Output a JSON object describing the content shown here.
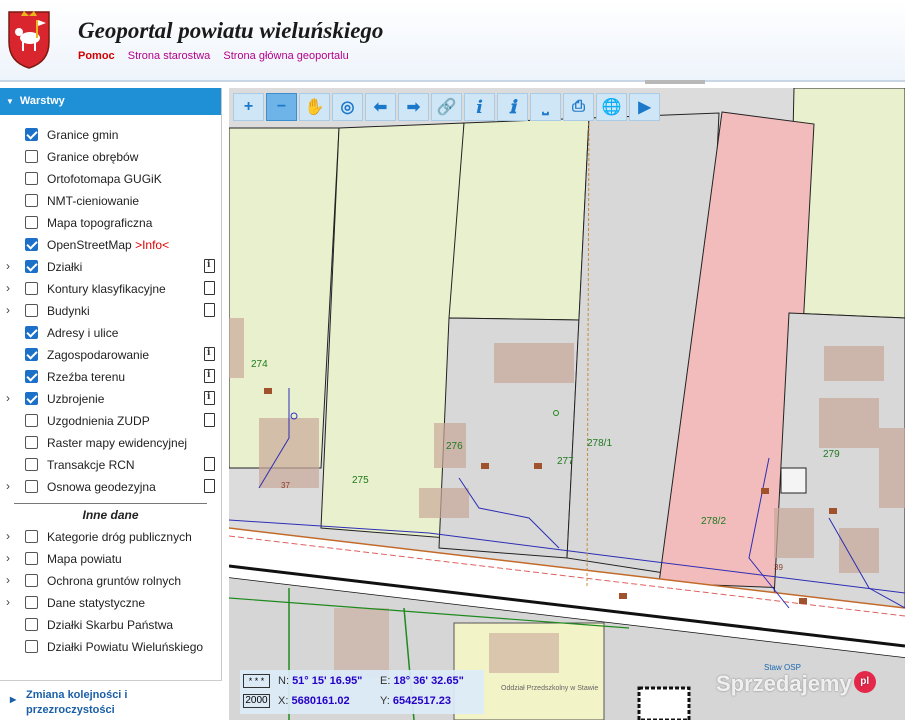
{
  "header": {
    "title": "Geoportal powiatu wieluńskiego",
    "links": {
      "help": "Pomoc",
      "starostwo": "Strona starostwa",
      "main": "Strona główna geoportalu"
    }
  },
  "sidebar": {
    "layers_title": "Warstwy",
    "layers": [
      {
        "label": "Granice gmin",
        "checked": true,
        "expand": false,
        "doc": ""
      },
      {
        "label": "Granice obrębów",
        "checked": false,
        "expand": false,
        "doc": ""
      },
      {
        "label": "Ortofotomapa GUGiK",
        "checked": false,
        "expand": false,
        "doc": ""
      },
      {
        "label": "NMT-cieniowanie",
        "checked": false,
        "expand": false,
        "doc": ""
      },
      {
        "label": "Mapa topograficzna",
        "checked": false,
        "expand": false,
        "doc": ""
      },
      {
        "label": "OpenStreetMap",
        "info": ">Info<",
        "checked": true,
        "expand": false,
        "doc": ""
      },
      {
        "label": "Działki",
        "checked": true,
        "expand": true,
        "doc": "info"
      },
      {
        "label": "Kontury klasyfikacyjne",
        "checked": false,
        "expand": true,
        "doc": "plain"
      },
      {
        "label": "Budynki",
        "checked": false,
        "expand": true,
        "doc": "plain"
      },
      {
        "label": "Adresy i ulice",
        "checked": true,
        "expand": false,
        "doc": ""
      },
      {
        "label": "Zagospodarowanie",
        "checked": true,
        "expand": false,
        "doc": "info"
      },
      {
        "label": "Rzeźba terenu",
        "checked": true,
        "expand": false,
        "doc": "info"
      },
      {
        "label": "Uzbrojenie",
        "checked": true,
        "expand": true,
        "doc": "info"
      },
      {
        "label": "Uzgodnienia ZUDP",
        "checked": false,
        "expand": false,
        "doc": "plain"
      },
      {
        "label": "Raster mapy ewidencyjnej",
        "checked": false,
        "expand": false,
        "doc": ""
      },
      {
        "label": "Transakcje RCN",
        "checked": false,
        "expand": false,
        "doc": "plain"
      },
      {
        "label": "Osnowa geodezyjna",
        "checked": false,
        "expand": true,
        "doc": "plain"
      }
    ],
    "other_title": "Inne dane",
    "other": [
      {
        "label": "Kategorie dróg publicznych",
        "checked": false,
        "expand": true
      },
      {
        "label": "Mapa powiatu",
        "checked": false,
        "expand": true
      },
      {
        "label": "Ochrona gruntów rolnych",
        "checked": false,
        "expand": true
      },
      {
        "label": "Dane statystyczne",
        "checked": false,
        "expand": true
      },
      {
        "label": "Działki Skarbu Państwa",
        "checked": false,
        "expand": false
      },
      {
        "label": "Działki Powiatu Wieluńskiego",
        "checked": false,
        "expand": false
      }
    ],
    "order_label_1": "Zmiana kolejności i",
    "order_label_2": "przezroczystości"
  },
  "toolbar": {
    "tools": [
      {
        "name": "zoom-in-icon",
        "glyph": "+",
        "active": false
      },
      {
        "name": "zoom-out-icon",
        "glyph": "−",
        "active": true
      },
      {
        "name": "pan-hand-icon",
        "glyph": "✋",
        "active": false
      },
      {
        "name": "zoom-extent-icon",
        "glyph": "◎",
        "active": false
      },
      {
        "name": "arrow-back-icon",
        "glyph": "⬅",
        "active": false
      },
      {
        "name": "arrow-forward-icon",
        "glyph": "➡",
        "active": false
      },
      {
        "name": "link-icon",
        "glyph": "🔗",
        "active": false
      },
      {
        "name": "info-icon",
        "glyph": "i",
        "active": false
      },
      {
        "name": "identify-icon",
        "glyph": "ℹ",
        "active": false
      },
      {
        "name": "measure-icon",
        "glyph": "⎵",
        "active": false
      },
      {
        "name": "print-icon",
        "glyph": "⎙",
        "active": false
      },
      {
        "name": "globe-icon",
        "glyph": "🌐",
        "active": false
      },
      {
        "name": "camera-icon",
        "glyph": "▶",
        "active": false
      }
    ]
  },
  "map": {
    "parcels": [
      "274",
      "275",
      "276",
      "277",
      "278/1",
      "278/2",
      "279",
      "37",
      "39"
    ],
    "labels": {
      "osp": "Staw OSP",
      "district": "Oddział Przedszkolny w Stawie"
    }
  },
  "coords": {
    "scale_top": "* * *",
    "scale_bottom": "2000",
    "n_label": "N:",
    "n_value": "51° 15' 16.95\"",
    "e_label": "E:",
    "e_value": "18° 36' 32.65\"",
    "x_label": "X:",
    "x_value": "5680161.02",
    "y_label": "Y:",
    "y_value": "6542517.23"
  },
  "watermark": {
    "text": "Sprzedajemy",
    "badge": "pl"
  }
}
